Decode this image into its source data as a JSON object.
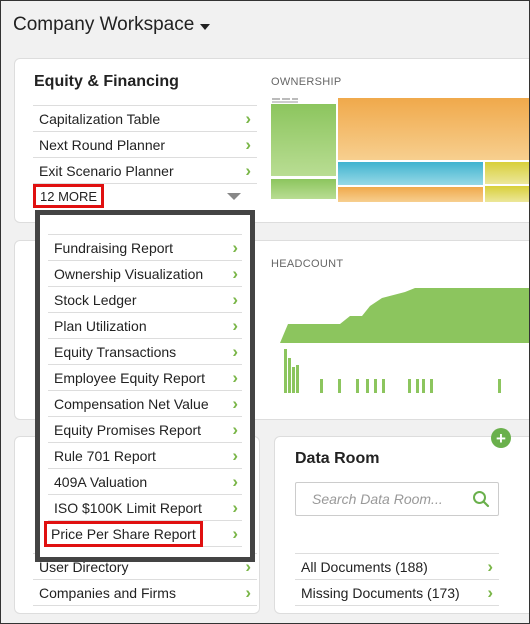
{
  "workspace": {
    "title": "Company Workspace"
  },
  "equity": {
    "title": "Equity & Financing",
    "items": [
      {
        "label": "Capitalization Table"
      },
      {
        "label": "Next Round Planner"
      },
      {
        "label": "Exit Scenario Planner"
      }
    ],
    "more_label": "12 MORE"
  },
  "ownership_chart": {
    "label": "OWNERSHIP"
  },
  "headcount_chart": {
    "label": "HEADCOUNT"
  },
  "more_menu": {
    "items": [
      {
        "label": "Fundraising Report"
      },
      {
        "label": "Ownership Visualization"
      },
      {
        "label": "Stock Ledger"
      },
      {
        "label": "Plan Utilization"
      },
      {
        "label": "Equity Transactions"
      },
      {
        "label": "Employee Equity Report"
      },
      {
        "label": "Compensation Net Value"
      },
      {
        "label": "Equity Promises Report"
      },
      {
        "label": "Rule 701 Report"
      },
      {
        "label": "409A Valuation"
      },
      {
        "label": "ISO $100K Limit Report"
      },
      {
        "label": "Price Per Share Report"
      }
    ]
  },
  "people": {
    "items": [
      {
        "label": "User Directory"
      },
      {
        "label": "Companies and Firms"
      }
    ]
  },
  "data_room": {
    "title": "Data Room",
    "search_placeholder": "Search Data Room...",
    "items": [
      {
        "label": "All Documents (188)"
      },
      {
        "label": "Missing Documents (173)"
      }
    ]
  },
  "icons": {
    "chevron": "chevron-right-icon",
    "add": "plus-icon",
    "search": "search-icon"
  },
  "colors": {
    "accent_green": "#7ab648",
    "highlight_red": "#e01010"
  }
}
